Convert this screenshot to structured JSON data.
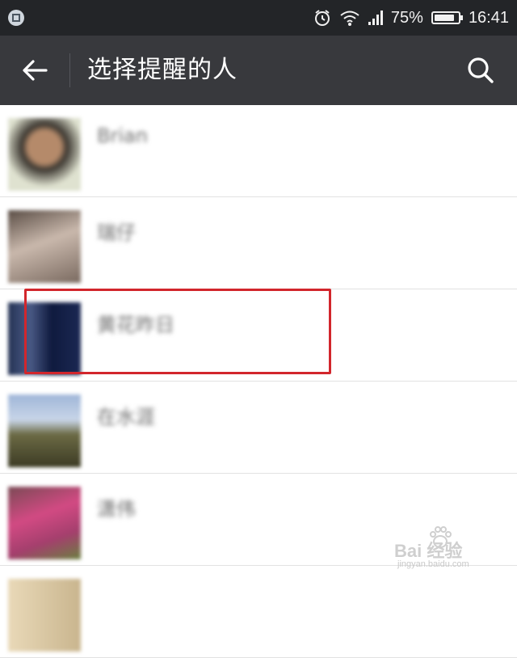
{
  "status_bar": {
    "battery": "75%",
    "time": "16:41",
    "icons": [
      "notification-app-icon",
      "alarm-icon",
      "wifi-icon",
      "signal-icon",
      "battery-icon"
    ]
  },
  "header": {
    "title": "选择提醒的人",
    "back_icon": "arrow-left-icon",
    "search_icon": "search-icon",
    "bg_color": "#38393d"
  },
  "contacts": [
    {
      "name": "Brian"
    },
    {
      "name": "瑞仔"
    },
    {
      "name": "黄花昨日"
    },
    {
      "name": "在水涯"
    },
    {
      "name": "潇伟"
    },
    {
      "name": ""
    }
  ],
  "highlight": {
    "target_index": 2,
    "color": "#d2262c"
  },
  "watermark": {
    "main": "Bai 经验",
    "sub": "jingyan.baidu.com"
  }
}
